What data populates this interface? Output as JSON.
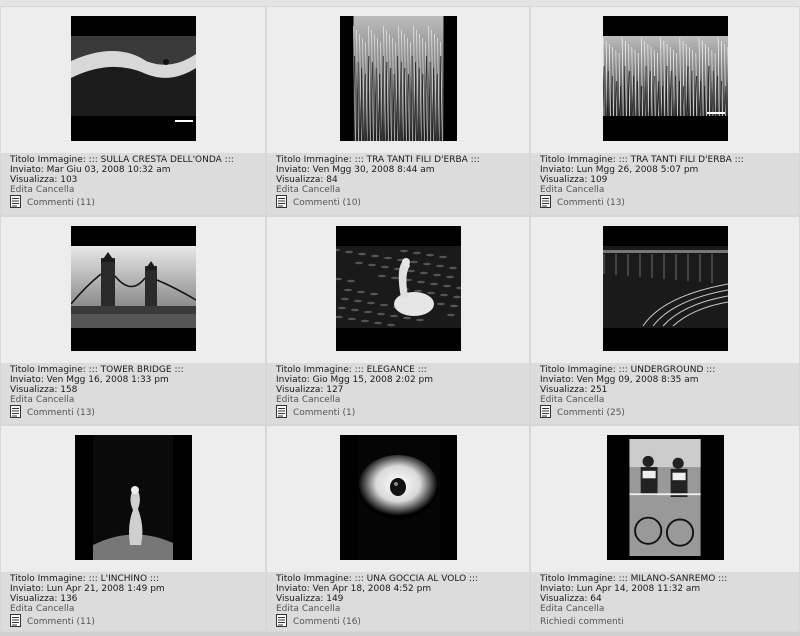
{
  "gallery": {
    "items": [
      {
        "title": "Titolo Immagine: ::: SULLA CRESTA DELL'ONDA :::",
        "posted": "Inviato: Mar Giu 03, 2008 10:32 am",
        "views": "Visualizza: 103",
        "edit": "Edita",
        "delete": "Cancella",
        "comments": "Commenti (11)",
        "thumb": "macro-leaf",
        "frame": "landscape"
      },
      {
        "title": "Titolo Immagine: ::: TRA TANTI FILI D'ERBA :::",
        "posted": "Inviato: Ven Mgg 30, 2008 8:44 am",
        "views": "Visualizza: 84",
        "edit": "Edita",
        "delete": "Cancella",
        "comments": "Commenti (10)",
        "thumb": "grass",
        "frame": "portrait"
      },
      {
        "title": "Titolo Immagine: ::: TRA TANTI FILI D'ERBA :::",
        "posted": "Inviato: Lun Mgg 26, 2008 5:07 pm",
        "views": "Visualizza: 109",
        "edit": "Edita",
        "delete": "Cancella",
        "comments": "Commenti (13)",
        "thumb": "grass-wide",
        "frame": "landscape"
      },
      {
        "title": "Titolo Immagine: ::: TOWER BRIDGE :::",
        "posted": "Inviato: Ven Mgg 16, 2008 1:33 pm",
        "views": "Visualizza: 158",
        "edit": "Edita",
        "delete": "Cancella",
        "comments": "Commenti (13)",
        "thumb": "bridge",
        "frame": "landscape"
      },
      {
        "title": "Titolo Immagine: ::: ELEGANCE :::",
        "posted": "Inviato: Gio Mgg 15, 2008 2:02 pm",
        "views": "Visualizza: 127",
        "edit": "Edita",
        "delete": "Cancella",
        "comments": "Commenti (1)",
        "thumb": "pelican",
        "frame": "landscape"
      },
      {
        "title": "Titolo Immagine: ::: UNDERGROUND :::",
        "posted": "Inviato: Ven Mgg 09, 2008 8:35 am",
        "views": "Visualizza: 251",
        "edit": "Edita",
        "delete": "Cancella",
        "comments": "Commenti (25)",
        "thumb": "tunnel",
        "frame": "landscape"
      },
      {
        "title": "Titolo Immagine: ::: L'INCHINO :::",
        "posted": "Inviato: Lun Apr 21, 2008 1:49 pm",
        "views": "Visualizza: 136",
        "edit": "Edita",
        "delete": "Cancella",
        "comments": "Commenti (11)",
        "thumb": "splash",
        "frame": "portrait-wide"
      },
      {
        "title": "Titolo Immagine: ::: UNA GOCCIA AL VOLO :::",
        "posted": "Inviato: Ven Apr 18, 2008 4:52 pm",
        "views": "Visualizza: 149",
        "edit": "Edita",
        "delete": "Cancella",
        "comments": "Commenti (16)",
        "thumb": "drop",
        "frame": "portrait-wide"
      },
      {
        "title": "Titolo Immagine: ::: MILANO-SANREMO :::",
        "posted": "Inviato: Lun Apr 14, 2008 11:32 am",
        "views": "Visualizza: 64",
        "edit": "Edita",
        "delete": "Cancella",
        "comments": "Richiedi commenti",
        "thumb": "cyclists",
        "frame": "portrait-wide",
        "no_icon": true
      }
    ]
  },
  "colors": {
    "cell_bg": "#ededed",
    "info_bg": "#dcdcdc",
    "text": "#1a1a1a",
    "muted": "#555555"
  }
}
